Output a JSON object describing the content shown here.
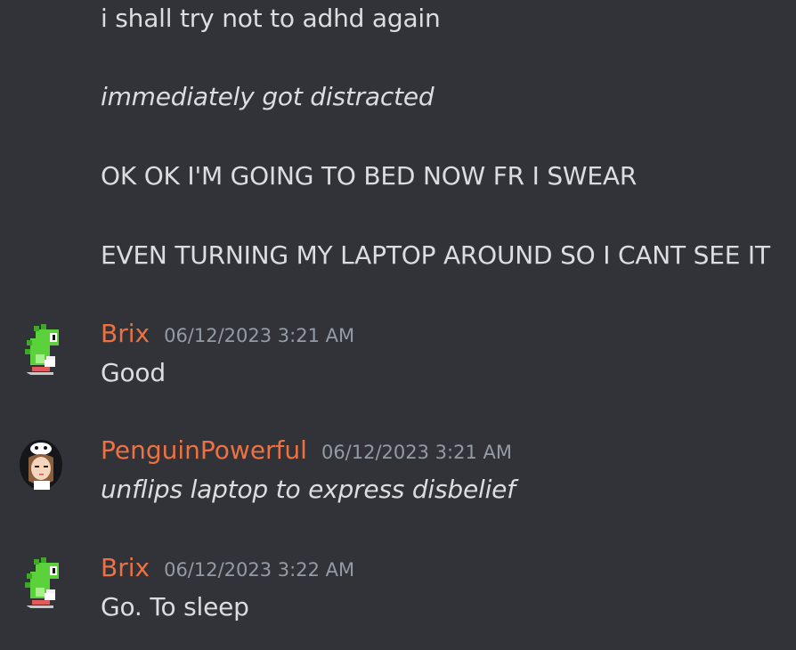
{
  "continued_messages": [
    "i shall try not to adhd again",
    "immediately got distracted",
    "OK OK I'M GOING TO BED NOW FR I SWEAR",
    "EVEN TURNING MY LAPTOP AROUND SO I CANT SEE IT"
  ],
  "messages": [
    {
      "author": "Brix",
      "timestamp": "06/12/2023 3:21 AM",
      "content": "Good",
      "avatar": "green-dinosaur-avatar"
    },
    {
      "author": "PenguinPowerful",
      "timestamp": "06/12/2023 3:21 AM",
      "content": "unflips laptop to express disbelief",
      "avatar": "penguin-hood-girl-avatar"
    },
    {
      "author": "Brix",
      "timestamp": "06/12/2023 3:22 AM",
      "content": "Go. To sleep",
      "avatar": "green-dinosaur-avatar"
    }
  ],
  "colors": {
    "background": "#313338",
    "username": "#ec7243",
    "timestamp": "#949ba4",
    "text": "#dbdee1"
  }
}
